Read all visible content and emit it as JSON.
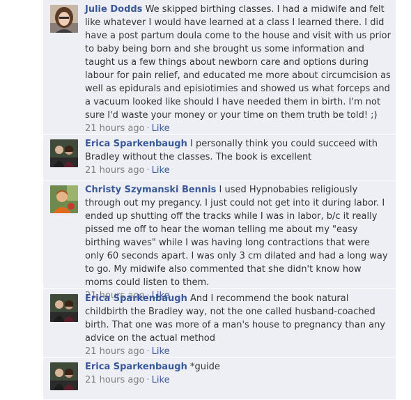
{
  "colors": {
    "feed_bg": "#edeff4",
    "author": "#3b5998",
    "text": "#333333",
    "meta": "#808080"
  },
  "comments": [
    {
      "author": "Julie Dodds",
      "avatar_icon": "woman-profile-photo-icon",
      "text": "We skipped birthing classes. I had a midwife and felt like whatever I would have learned at a class I learned there. I did have a post partum doula come to the house and visit with us prior to baby being born and she brought us some information and taught us a few things about newborn care and options during labour for pain relief, and educated me more about circumcision as well as epidurals and episiotimies and showed us what forceps and a vacuum looked like should I have needed them in birth. I'm not sure I'd waste your money or your time on them truth be told! ;)",
      "time": "21 hours ago",
      "like": "Like"
    },
    {
      "author": "Erica Sparkenbaugh",
      "avatar_icon": "couple-profile-photo-icon",
      "text": "I personally think you could succeed with Bradley without the classes. The book is excellent",
      "time": "21 hours ago",
      "like": "Like"
    },
    {
      "author": "Christy Szymanski Bennis",
      "avatar_icon": "child-profile-photo-icon",
      "text": "I used Hypnobabies religiously through out my pregancy. I just could not get into it during labor. I ended up shutting off the tracks while I was in labor, b/c it really pissed me off to hear the woman telling me about my \"easy birthing waves\" while I was having long contractions that were only 60 seconds apart. I was only 3 cm dilated and had a long way to go. My midwife also commented that she didn't know how moms could listen to them.",
      "time": "21 hours ago",
      "like": "Like"
    },
    {
      "author": "Erica Sparkenbaugh",
      "avatar_icon": "couple-profile-photo-icon",
      "text": "And I recommend the book natural childbirth the Bradley way, not the one called husband-coached birth. That one was more of a man's house to pregnancy than any advice on the actual method",
      "time": "21 hours ago",
      "like": "Like"
    },
    {
      "author": "Erica Sparkenbaugh",
      "avatar_icon": "couple-profile-photo-icon",
      "text": "*guide",
      "time": "21 hours ago",
      "like": "Like"
    }
  ]
}
